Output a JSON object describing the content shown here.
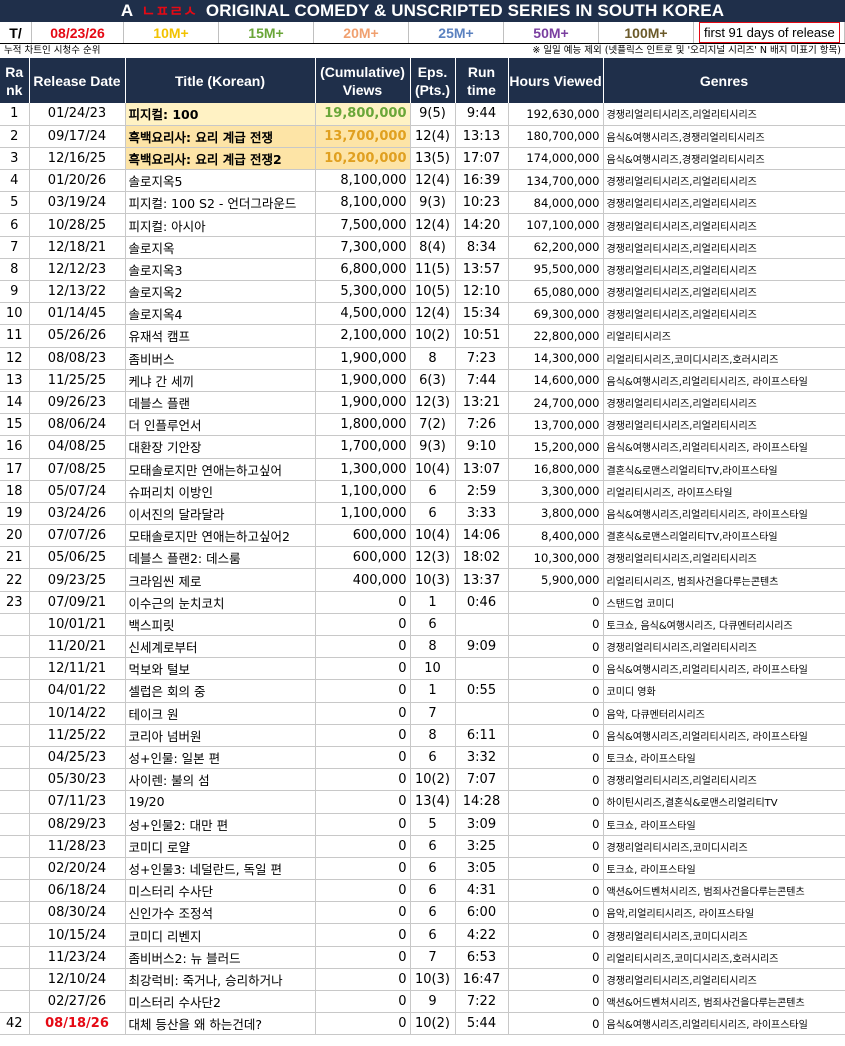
{
  "header": {
    "prefix": "A",
    "brand": "ㄴㅍㄹㅅ",
    "title": "ORIGINAL COMEDY & UNSCRIPTED SERIES IN SOUTH KOREA"
  },
  "legend": {
    "t_label": "T/",
    "date": "08/23/26",
    "tiers": [
      {
        "label": "10M+",
        "color": "#f2c200"
      },
      {
        "label": "15M+",
        "color": "#6aa639"
      },
      {
        "label": "20M+",
        "color": "#f0a070"
      },
      {
        "label": "25M+",
        "color": "#5b82c0"
      },
      {
        "label": "50M+",
        "color": "#7a3fa0"
      },
      {
        "label": "100M+",
        "color": "#6b5a2a"
      }
    ],
    "note": "first 91 days of release"
  },
  "subnote": {
    "left": "누적 차트인 시청수 순위",
    "right": "※ 일일 예능 제외 (넷플릭스 인트로 및 '오리지널 시리즈' N 배지 미표기 항목)"
  },
  "columns": {
    "rank": "Ra nk",
    "release": "Release Date",
    "title": "Title (Korean)",
    "views": "(Cumulative) Views",
    "eps": "Eps. (Pts.)",
    "runtime": "Run time",
    "hours": "Hours Viewed",
    "genres": "Genres"
  },
  "rows": [
    {
      "rank": "1",
      "date": "01/24/23",
      "title": "피지컬: 100",
      "views": "19,800,000",
      "eps": "9(5)",
      "run": "9:44",
      "hours": "192,630,000",
      "genres": "경쟁리얼리티시리즈,리얼리티시리즈",
      "hl": "hl1"
    },
    {
      "rank": "2",
      "date": "09/17/24",
      "title": "흑백요리사: 요리 계급 전쟁",
      "views": "13,700,000",
      "eps": "12(4)",
      "run": "13:13",
      "hours": "180,700,000",
      "genres": "음식&여행시리즈,경쟁리얼리티시리즈",
      "hl": "hl2"
    },
    {
      "rank": "3",
      "date": "12/16/25",
      "title": "흑백요리사: 요리 계급 전쟁2",
      "views": "10,200,000",
      "eps": "13(5)",
      "run": "17:07",
      "hours": "174,000,000",
      "genres": "음식&여행시리즈,경쟁리얼리티시리즈",
      "hl": "hl2"
    },
    {
      "rank": "4",
      "date": "01/20/26",
      "title": "솔로지옥5",
      "views": "8,100,000",
      "eps": "12(4)",
      "run": "16:39",
      "hours": "134,700,000",
      "genres": "경쟁리얼리티시리즈,리얼리티시리즈",
      "hl": ""
    },
    {
      "rank": "5",
      "date": "03/19/24",
      "title": "피지컬: 100 S2 - 언더그라운드",
      "views": "8,100,000",
      "eps": "9(3)",
      "run": "10:23",
      "hours": "84,000,000",
      "genres": "경쟁리얼리티시리즈,리얼리티시리즈",
      "hl": ""
    },
    {
      "rank": "6",
      "date": "10/28/25",
      "title": "피지컬: 아시아",
      "views": "7,500,000",
      "eps": "12(4)",
      "run": "14:20",
      "hours": "107,100,000",
      "genres": "경쟁리얼리티시리즈,리얼리티시리즈",
      "hl": ""
    },
    {
      "rank": "7",
      "date": "12/18/21",
      "title": "솔로지옥",
      "views": "7,300,000",
      "eps": "8(4)",
      "run": "8:34",
      "hours": "62,200,000",
      "genres": "경쟁리얼리티시리즈,리얼리티시리즈",
      "hl": ""
    },
    {
      "rank": "8",
      "date": "12/12/23",
      "title": "솔로지옥3",
      "views": "6,800,000",
      "eps": "11(5)",
      "run": "13:57",
      "hours": "95,500,000",
      "genres": "경쟁리얼리티시리즈,리얼리티시리즈",
      "hl": ""
    },
    {
      "rank": "9",
      "date": "12/13/22",
      "title": "솔로지옥2",
      "views": "5,300,000",
      "eps": "10(5)",
      "run": "12:10",
      "hours": "65,080,000",
      "genres": "경쟁리얼리티시리즈,리얼리티시리즈",
      "hl": ""
    },
    {
      "rank": "10",
      "date": "01/14/45",
      "title": "솔로지옥4",
      "views": "4,500,000",
      "eps": "12(4)",
      "run": "15:34",
      "hours": "69,300,000",
      "genres": "경쟁리얼리티시리즈,리얼리티시리즈",
      "hl": ""
    },
    {
      "rank": "11",
      "date": "05/26/26",
      "title": "유재석 캠프",
      "views": "2,100,000",
      "eps": "10(2)",
      "run": "10:51",
      "hours": "22,800,000",
      "genres": "리얼리티시리즈",
      "hl": ""
    },
    {
      "rank": "12",
      "date": "08/08/23",
      "title": "좀비버스",
      "views": "1,900,000",
      "eps": "8",
      "run": "7:23",
      "hours": "14,300,000",
      "genres": "리얼리티시리즈,코미디시리즈,호러시리즈",
      "hl": ""
    },
    {
      "rank": "13",
      "date": "11/25/25",
      "title": "케냐 간 세끼",
      "views": "1,900,000",
      "eps": "6(3)",
      "run": "7:44",
      "hours": "14,600,000",
      "genres": "음식&여행시리즈,리얼리티시리즈, 라이프스타일",
      "hl": ""
    },
    {
      "rank": "14",
      "date": "09/26/23",
      "title": "데블스 플랜",
      "views": "1,900,000",
      "eps": "12(3)",
      "run": "13:21",
      "hours": "24,700,000",
      "genres": "경쟁리얼리티시리즈,리얼리티시리즈",
      "hl": ""
    },
    {
      "rank": "15",
      "date": "08/06/24",
      "title": "더 인플루언서",
      "views": "1,800,000",
      "eps": "7(2)",
      "run": "7:26",
      "hours": "13,700,000",
      "genres": "경쟁리얼리티시리즈,리얼리티시리즈",
      "hl": ""
    },
    {
      "rank": "16",
      "date": "04/08/25",
      "title": "대환장 기안장",
      "views": "1,700,000",
      "eps": "9(3)",
      "run": "9:10",
      "hours": "15,200,000",
      "genres": "음식&여행시리즈,리얼리티시리즈, 라이프스타일",
      "hl": ""
    },
    {
      "rank": "17",
      "date": "07/08/25",
      "title": "모태솔로지만 연애는하고싶어",
      "views": "1,300,000",
      "eps": "10(4)",
      "run": "13:07",
      "hours": "16,800,000",
      "genres": "결혼식&로맨스리얼리티TV,라이프스타일",
      "hl": ""
    },
    {
      "rank": "18",
      "date": "05/07/24",
      "title": "슈퍼리치 이방인",
      "views": "1,100,000",
      "eps": "6",
      "run": "2:59",
      "hours": "3,300,000",
      "genres": "리얼리티시리즈, 라이프스타일",
      "hl": ""
    },
    {
      "rank": "19",
      "date": "03/24/26",
      "title": "이서진의 달라달라",
      "views": "1,100,000",
      "eps": "6",
      "run": "3:33",
      "hours": "3,800,000",
      "genres": "음식&여행시리즈,리얼리티시리즈, 라이프스타일",
      "hl": ""
    },
    {
      "rank": "20",
      "date": "07/07/26",
      "title": "모태솔로지만 연애는하고싶어2",
      "views": "600,000",
      "eps": "10(4)",
      "run": "14:06",
      "hours": "8,400,000",
      "genres": "결혼식&로맨스리얼리티TV,라이프스타일",
      "hl": ""
    },
    {
      "rank": "21",
      "date": "05/06/25",
      "title": "데블스 플랜2: 데스룸",
      "views": "600,000",
      "eps": "12(3)",
      "run": "18:02",
      "hours": "10,300,000",
      "genres": "경쟁리얼리티시리즈,리얼리티시리즈",
      "hl": ""
    },
    {
      "rank": "22",
      "date": "09/23/25",
      "title": "크라임씬 제로",
      "views": "400,000",
      "eps": "10(3)",
      "run": "13:37",
      "hours": "5,900,000",
      "genres": "리얼리티시리즈, 범죄사건을다루는콘텐츠",
      "hl": ""
    },
    {
      "rank": "23",
      "date": "07/09/21",
      "title": "이수근의 눈치코치",
      "views": "0",
      "eps": "1",
      "run": "0:46",
      "hours": "0",
      "genres": "스탠드업 코미디",
      "hl": ""
    },
    {
      "rank": "",
      "date": "10/01/21",
      "title": "백스피릿",
      "views": "0",
      "eps": "6",
      "run": "",
      "hours": "0",
      "genres": "토크쇼, 음식&여행시리즈, 다큐멘터리시리즈",
      "hl": ""
    },
    {
      "rank": "",
      "date": "11/20/21",
      "title": "신세계로부터",
      "views": "0",
      "eps": "8",
      "run": "9:09",
      "hours": "0",
      "genres": "경쟁리얼리티시리즈,리얼리티시리즈",
      "hl": ""
    },
    {
      "rank": "",
      "date": "12/11/21",
      "title": "먹보와 털보",
      "views": "0",
      "eps": "10",
      "run": "",
      "hours": "0",
      "genres": "음식&여행시리즈,리얼리티시리즈, 라이프스타일",
      "hl": ""
    },
    {
      "rank": "",
      "date": "04/01/22",
      "title": "셀럽은 회의 중",
      "views": "0",
      "eps": "1",
      "run": "0:55",
      "hours": "0",
      "genres": "코미디 영화",
      "hl": ""
    },
    {
      "rank": "",
      "date": "10/14/22",
      "title": "테이크 원",
      "views": "0",
      "eps": "7",
      "run": "",
      "hours": "0",
      "genres": "음악, 다큐멘터리시리즈",
      "hl": ""
    },
    {
      "rank": "",
      "date": "11/25/22",
      "title": "코리아 넘버원",
      "views": "0",
      "eps": "8",
      "run": "6:11",
      "hours": "0",
      "genres": "음식&여행시리즈,리얼리티시리즈, 라이프스타일",
      "hl": ""
    },
    {
      "rank": "",
      "date": "04/25/23",
      "title": "성+인물: 일본 편",
      "views": "0",
      "eps": "6",
      "run": "3:32",
      "hours": "0",
      "genres": "토크쇼, 라이프스타일",
      "hl": ""
    },
    {
      "rank": "",
      "date": "05/30/23",
      "title": "사이렌: 불의 섬",
      "views": "0",
      "eps": "10(2)",
      "run": "7:07",
      "hours": "0",
      "genres": "경쟁리얼리티시리즈,리얼리티시리즈",
      "hl": ""
    },
    {
      "rank": "",
      "date": "07/11/23",
      "title": "19/20",
      "views": "0",
      "eps": "13(4)",
      "run": "14:28",
      "hours": "0",
      "genres": "하이틴시리즈,결혼식&로맨스리얼리티TV",
      "hl": ""
    },
    {
      "rank": "",
      "date": "08/29/23",
      "title": "성+인물2: 대만 편",
      "views": "0",
      "eps": "5",
      "run": "3:09",
      "hours": "0",
      "genres": "토크쇼, 라이프스타일",
      "hl": ""
    },
    {
      "rank": "",
      "date": "11/28/23",
      "title": "코미디 로얄",
      "views": "0",
      "eps": "6",
      "run": "3:25",
      "hours": "0",
      "genres": "경쟁리얼리티시리즈,코미디시리즈",
      "hl": ""
    },
    {
      "rank": "",
      "date": "02/20/24",
      "title": "성+인물3: 네덜란드, 독일 편",
      "views": "0",
      "eps": "6",
      "run": "3:05",
      "hours": "0",
      "genres": "토크쇼, 라이프스타일",
      "hl": ""
    },
    {
      "rank": "",
      "date": "06/18/24",
      "title": "미스터리 수사단",
      "views": "0",
      "eps": "6",
      "run": "4:31",
      "hours": "0",
      "genres": "액션&어드벤처시리즈, 범죄사건을다루는콘텐츠",
      "hl": ""
    },
    {
      "rank": "",
      "date": "08/30/24",
      "title": "신인가수 조정석",
      "views": "0",
      "eps": "6",
      "run": "6:00",
      "hours": "0",
      "genres": "음악,리얼리티시리즈, 라이프스타일",
      "hl": ""
    },
    {
      "rank": "",
      "date": "10/15/24",
      "title": "코미디 리벤지",
      "views": "0",
      "eps": "6",
      "run": "4:22",
      "hours": "0",
      "genres": "경쟁리얼리티시리즈,코미디시리즈",
      "hl": ""
    },
    {
      "rank": "",
      "date": "11/23/24",
      "title": "좀비버스2: 뉴 블러드",
      "views": "0",
      "eps": "7",
      "run": "6:53",
      "hours": "0",
      "genres": "리얼리티시리즈,코미디시리즈,호러시리즈",
      "hl": ""
    },
    {
      "rank": "",
      "date": "12/10/24",
      "title": "최강럭비: 죽거나, 승리하거나",
      "views": "0",
      "eps": "10(3)",
      "run": "16:47",
      "hours": "0",
      "genres": "경쟁리얼리티시리즈,리얼리티시리즈",
      "hl": ""
    },
    {
      "rank": "",
      "date": "02/27/26",
      "title": "미스터리 수사단2",
      "views": "0",
      "eps": "9",
      "run": "7:22",
      "hours": "0",
      "genres": "액션&어드벤처시리즈, 범죄사건을다루는콘텐츠",
      "hl": ""
    },
    {
      "rank": "42",
      "date": "08/18/26",
      "title": "대체 등산을 왜 하는건데?",
      "views": "0",
      "eps": "10(2)",
      "run": "5:44",
      "hours": "0",
      "genres": "음식&여행시리즈,리얼리티시리즈, 라이프스타일",
      "hl": "",
      "date_red": true
    }
  ]
}
